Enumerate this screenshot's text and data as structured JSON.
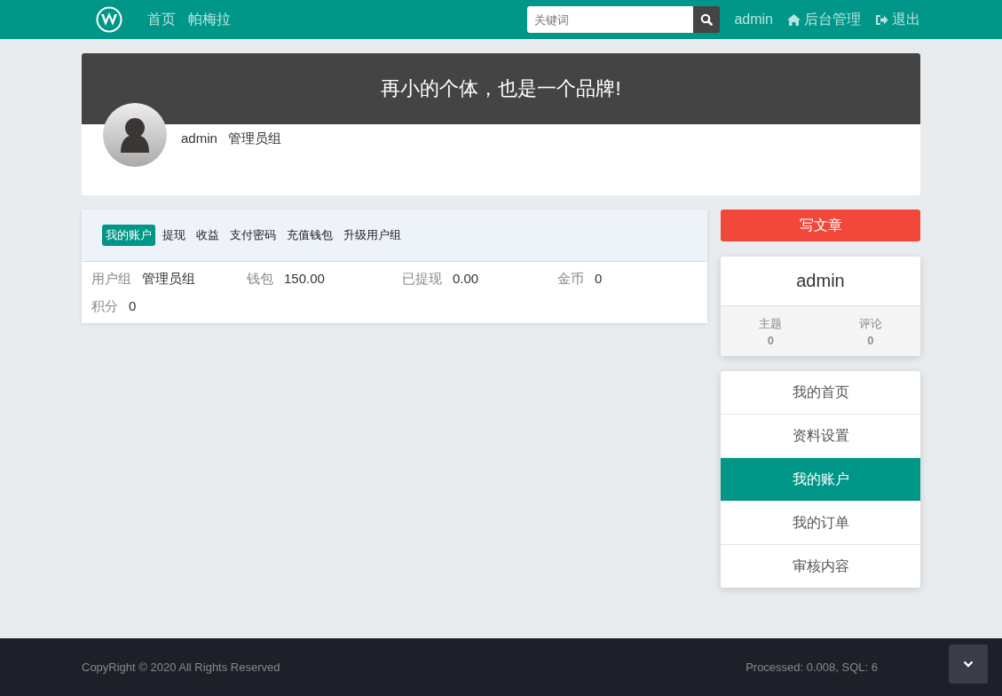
{
  "navbar": {
    "links": [
      "首页",
      "帕梅拉"
    ],
    "search": {
      "placeholder": "关键词"
    },
    "user": "admin",
    "admin_link": "后台管理",
    "logout": "退出"
  },
  "banner": {
    "slogan": "再小的个体，也是一个品牌!",
    "username": "admin",
    "group": "管理员组"
  },
  "account": {
    "tabs": [
      {
        "label": "我的账户",
        "selected": true
      },
      {
        "label": "提现",
        "selected": false
      },
      {
        "label": "收益",
        "selected": false
      },
      {
        "label": "支付密码",
        "selected": false
      },
      {
        "label": "充值钱包",
        "selected": false
      },
      {
        "label": "升级用户组",
        "selected": false
      }
    ],
    "fields": [
      {
        "label": "用户组",
        "value": "管理员组"
      },
      {
        "label": "钱包",
        "value": "150.00"
      },
      {
        "label": "已提现",
        "value": "0.00"
      },
      {
        "label": "金币",
        "value": "0"
      },
      {
        "label": "积分",
        "value": "0"
      }
    ]
  },
  "sidebar": {
    "write_button": "写文章",
    "profile": {
      "name": "admin",
      "stats": [
        {
          "label": "主题",
          "value": "0"
        },
        {
          "label": "评论",
          "value": "0"
        }
      ]
    },
    "menu": [
      {
        "label": "我的首页",
        "selected": false
      },
      {
        "label": "资料设置",
        "selected": false
      },
      {
        "label": "我的账户",
        "selected": true
      },
      {
        "label": "我的订单",
        "selected": false
      },
      {
        "label": "审核内容",
        "selected": false
      }
    ]
  },
  "footer": {
    "copyright": "CopyRight © 2020 All Rights Reserved",
    "stats": "Processed: 0.008, SQL: 6"
  }
}
